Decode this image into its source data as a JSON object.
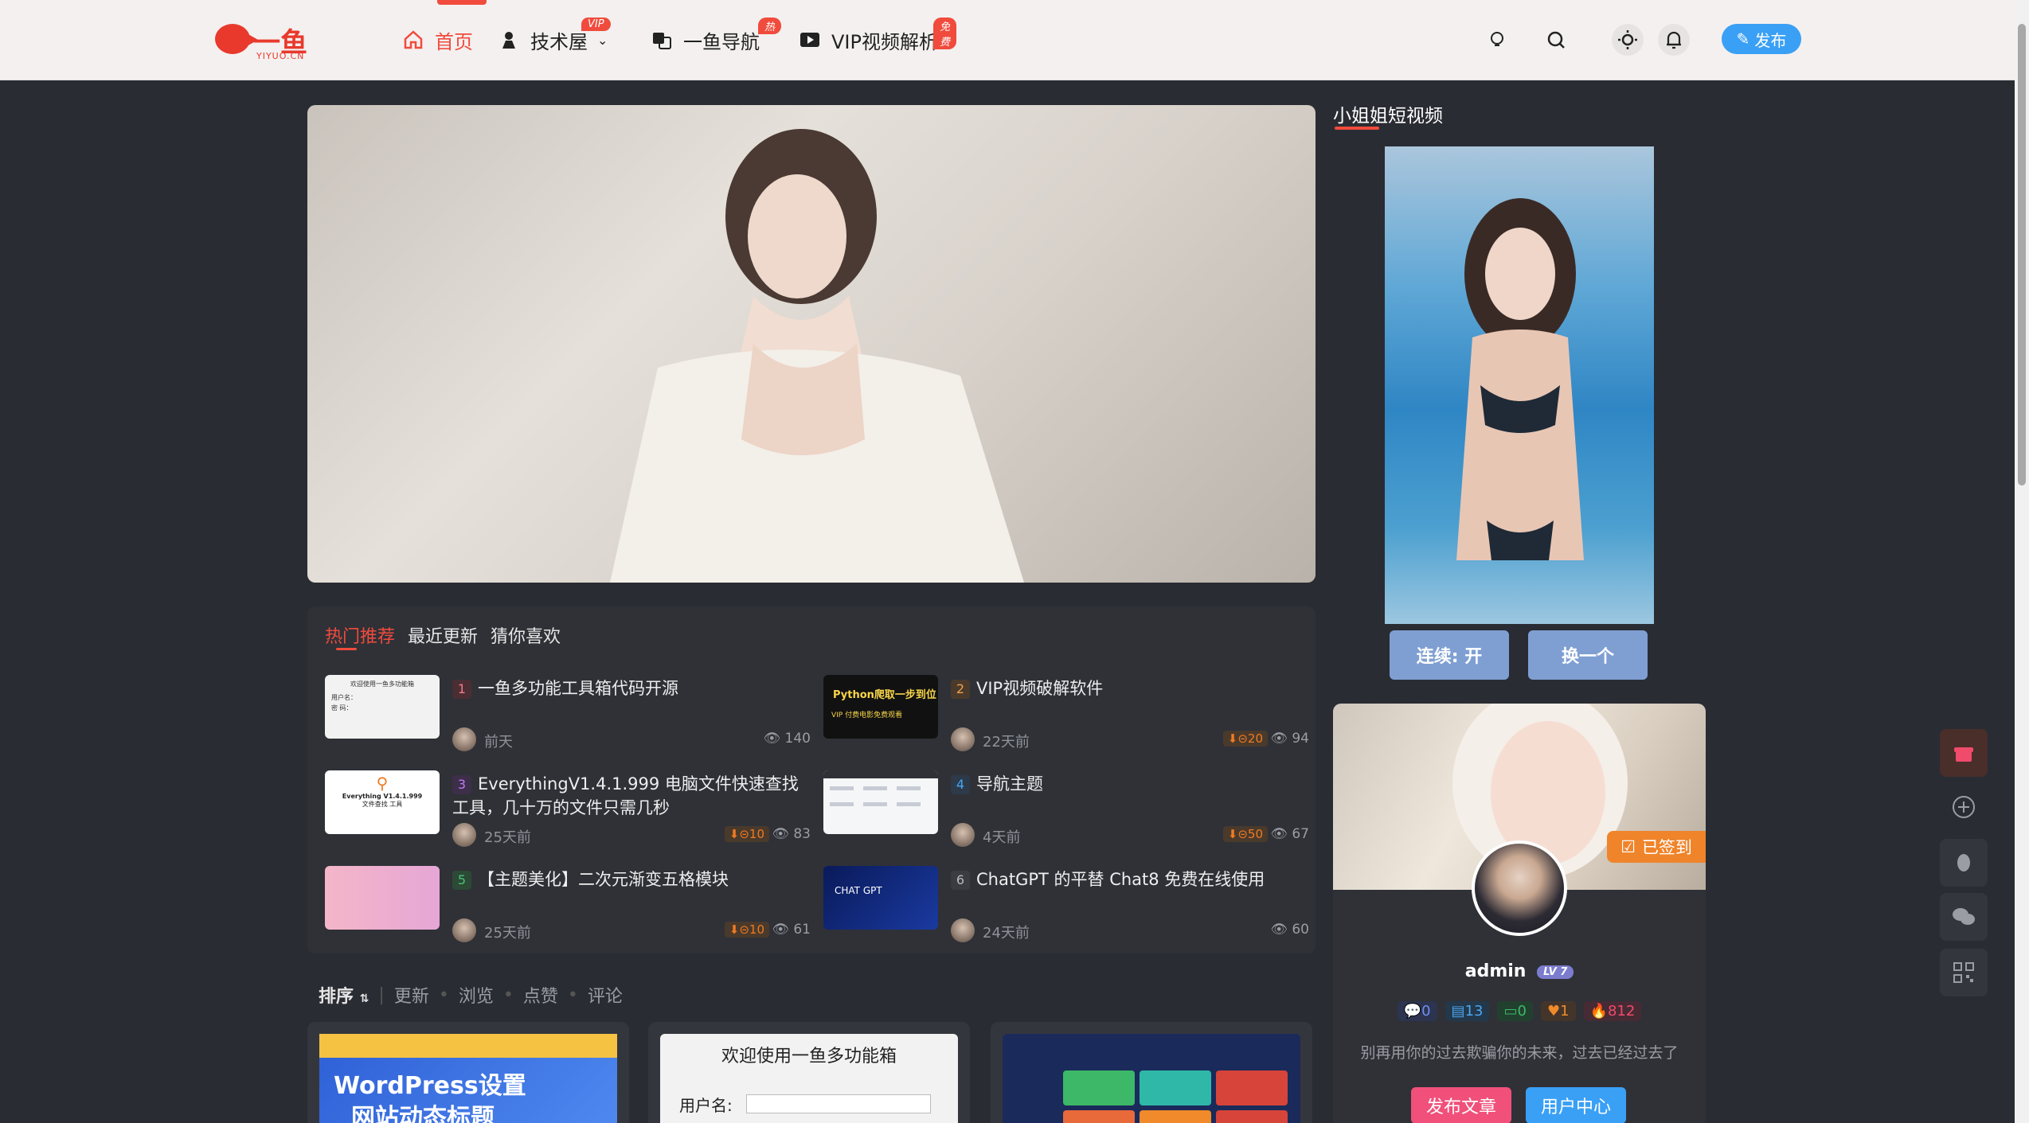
{
  "header": {
    "logo_text": "一鱼",
    "logo_sub": "YIYUO.CN",
    "nav": [
      {
        "label": "首页",
        "icon": "home-icon",
        "active": true
      },
      {
        "label": "技术屋",
        "icon": "tech-icon",
        "badge": "VIP"
      },
      {
        "label": "一鱼导航",
        "icon": "translate-icon",
        "badge": "热"
      },
      {
        "label": "VIP视频解析",
        "icon": "video-play-icon",
        "badge": "免费"
      }
    ],
    "publish_label": "发布"
  },
  "hot": {
    "tabs": [
      "热门推荐",
      "最近更新",
      "猜你喜欢"
    ],
    "posts": [
      {
        "rank": "1",
        "title": "一鱼多功能工具箱代码开源",
        "time": "前天",
        "views": "140",
        "downloads": ""
      },
      {
        "rank": "2",
        "title": "VIP视频破解软件",
        "time": "22天前",
        "views": "94",
        "downloads": "20"
      },
      {
        "rank": "3",
        "title": "EverythingV1.4.1.999 电脑文件快速查找工具，几十万的文件只需几秒",
        "time": "25天前",
        "views": "83",
        "downloads": "10"
      },
      {
        "rank": "4",
        "title": "导航主题",
        "time": "4天前",
        "views": "67",
        "downloads": "50"
      },
      {
        "rank": "5",
        "title": "【主题美化】二次元渐变五格模块",
        "time": "25天前",
        "views": "61",
        "downloads": "10"
      },
      {
        "rank": "6",
        "title": "ChatGPT 的平替 Chat8 免费在线使用",
        "time": "24天前",
        "views": "60",
        "downloads": ""
      }
    ],
    "thumb_texts": {
      "toolbox_title": "欢迎使用一鱼多功能箱",
      "toolbox_user": "用户名：",
      "toolbox_pass": "密 码：",
      "python": "Python爬取一步到位",
      "vip_line": "VIP 付费电影免费观看",
      "everything1": "Everything V1.4.1.999",
      "everything2": "文件查找 工具",
      "chatgpt": "CHAT GPT"
    }
  },
  "sort": {
    "label": "排序",
    "options": [
      "更新",
      "浏览",
      "点赞",
      "评论"
    ]
  },
  "cards": {
    "wp_line1": "WordPress设置",
    "wp_line2": "网站动态标题",
    "toolbox_title": "欢迎使用一鱼多功能箱",
    "toolbox_user": "用户名:"
  },
  "sidebar": {
    "title": "小姐姐短视频",
    "btn_continuous": "连续: 开",
    "btn_next": "换一个"
  },
  "profile": {
    "signed": "已签到",
    "name": "admin",
    "level": "LV 7",
    "stats": [
      {
        "icon": "comment-icon",
        "value": "0",
        "color": "#6d8ff0"
      },
      {
        "icon": "article-icon",
        "value": "13",
        "color": "#4aa6f0"
      },
      {
        "icon": "message-icon",
        "value": "0",
        "color": "#3cb868"
      },
      {
        "icon": "heart-icon",
        "value": "1",
        "color": "#f08a2a"
      },
      {
        "icon": "fire-icon",
        "value": "812",
        "color": "#f04b6a"
      }
    ],
    "motto": "别再用你的过去欺骗你的未来，过去已经过去了",
    "btn_publish": "发布文章",
    "btn_center": "用户中心"
  }
}
